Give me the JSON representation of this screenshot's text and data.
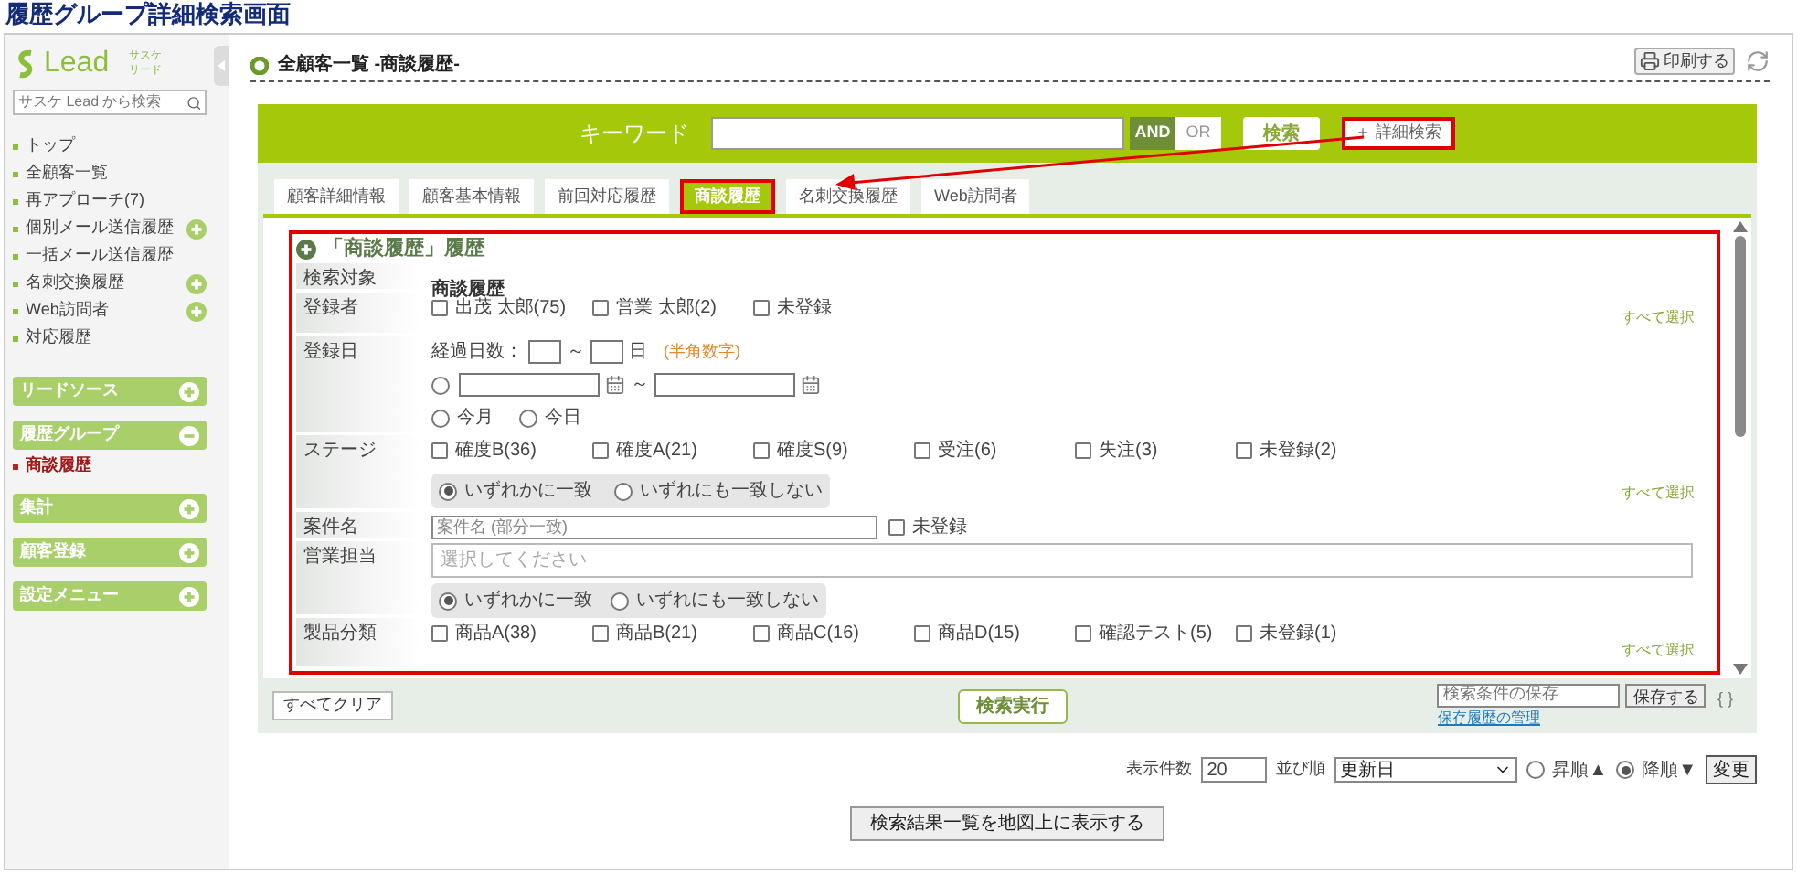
{
  "page_title": "履歴グループ詳細検索画面",
  "sidebar": {
    "logo": {
      "text": "Lead",
      "sub_1": "サスケ",
      "sub_2": "リード"
    },
    "search": {
      "placeholder": "サスケ Lead から検索"
    },
    "nav_items": [
      {
        "label": "トップ",
        "expandable": false
      },
      {
        "label": "全顧客一覧",
        "expandable": false
      },
      {
        "label": "再アプローチ(7)",
        "expandable": false
      },
      {
        "label": "個別メール送信履歴",
        "expandable": true
      },
      {
        "label": "一括メール送信履歴",
        "expandable": false
      },
      {
        "label": "名刺交換履歴",
        "expandable": true
      },
      {
        "label": "Web訪問者",
        "expandable": true
      },
      {
        "label": "対応履歴",
        "expandable": false
      }
    ],
    "sections": [
      {
        "label": "リードソース",
        "expanded": false
      },
      {
        "label": "履歴グループ",
        "expanded": true,
        "children": [
          {
            "label": "商談履歴",
            "selected": true
          }
        ]
      },
      {
        "label": "集計",
        "expanded": false
      },
      {
        "label": "顧客登録",
        "expanded": false
      },
      {
        "label": "設定メニュー",
        "expanded": false
      }
    ]
  },
  "header": {
    "breadcrumb": "全顧客一覧 -商談履歴-",
    "print_button": "印刷する"
  },
  "search_bar": {
    "label": "キーワード",
    "match_modes": [
      {
        "label": "AND",
        "selected": true
      },
      {
        "label": "OR",
        "selected": false
      }
    ],
    "search_button": "検索",
    "detail_button": {
      "label": "＋ 詳細検索",
      "highlighted": true
    }
  },
  "tabs": [
    {
      "label": "顧客詳細情報",
      "selected": false,
      "highlighted": false
    },
    {
      "label": "顧客基本情報",
      "selected": false,
      "highlighted": false
    },
    {
      "label": "前回対応履歴",
      "selected": false,
      "highlighted": false
    },
    {
      "label": "商談履歴",
      "selected": true,
      "highlighted": true
    },
    {
      "label": "名刺交換履歴",
      "selected": false,
      "highlighted": false
    },
    {
      "label": "Web訪問者",
      "selected": false,
      "highlighted": false
    }
  ],
  "form": {
    "title": "「商談履歴」履歴",
    "highlighted": true,
    "rows": [
      {
        "kind": "text",
        "label": "検索対象",
        "value": "商談履歴"
      },
      {
        "kind": "checks",
        "label": "登録者",
        "options": [
          {
            "label": "出茂 太郎(75)",
            "checked": false
          },
          {
            "label": "営業 太郎(2)",
            "checked": false
          },
          {
            "label": "未登録",
            "checked": false
          }
        ],
        "select_all": "すべて選択"
      },
      {
        "kind": "date",
        "label": "登録日",
        "elapsed_label": "経過日数：",
        "range_sep": "～",
        "unit": "日",
        "hint": "(半角数字)",
        "range_selected": false,
        "date_sep": "～",
        "presets": [
          {
            "label": "今月",
            "selected": false
          },
          {
            "label": "今日",
            "selected": false
          }
        ]
      },
      {
        "kind": "checks",
        "label": "ステージ",
        "options": [
          {
            "label": "確度B(36)",
            "checked": false
          },
          {
            "label": "確度A(21)",
            "checked": false
          },
          {
            "label": "確度S(9)",
            "checked": false
          },
          {
            "label": "受注(6)",
            "checked": false
          },
          {
            "label": "失注(3)",
            "checked": false
          },
          {
            "label": "未登録(2)",
            "checked": false
          }
        ],
        "match": [
          {
            "label": "いずれかに一致",
            "selected": true
          },
          {
            "label": "いずれにも一致しない",
            "selected": false
          }
        ],
        "select_all": "すべて選択"
      },
      {
        "kind": "text_input",
        "label": "案件名",
        "placeholder": "案件名 (部分一致)",
        "extra": {
          "label": "未登録",
          "checked": false
        }
      },
      {
        "kind": "select_input",
        "label": "営業担当",
        "placeholder": "選択してください",
        "match": [
          {
            "label": "いずれかに一致",
            "selected": true
          },
          {
            "label": "いずれにも一致しない",
            "selected": false
          }
        ]
      },
      {
        "kind": "checks",
        "label": "製品分類",
        "options": [
          {
            "label": "商品A(38)",
            "checked": false
          },
          {
            "label": "商品B(21)",
            "checked": false
          },
          {
            "label": "商品C(16)",
            "checked": false
          },
          {
            "label": "商品D(15)",
            "checked": false
          },
          {
            "label": "確認テスト(5)",
            "checked": false
          },
          {
            "label": "未登録(1)",
            "checked": false
          }
        ],
        "select_all": "すべて選択"
      }
    ]
  },
  "footer": {
    "clear_button": "すべてクリア",
    "run_button": "検索実行",
    "save_field": {
      "placeholder": "検索条件の保存"
    },
    "save_button": "保存する",
    "manage_link": "保存履歴の管理",
    "braces": "{ }"
  },
  "list_options": {
    "count_label": "表示件数",
    "count_value": "20",
    "sort_label": "並び順",
    "sort_value": "更新日",
    "orders": [
      {
        "label": "昇順▲",
        "selected": false
      },
      {
        "label": "降順▼",
        "selected": true
      }
    ],
    "change_button": "変更"
  },
  "map_button": "検索結果一覧を地図上に表示する"
}
